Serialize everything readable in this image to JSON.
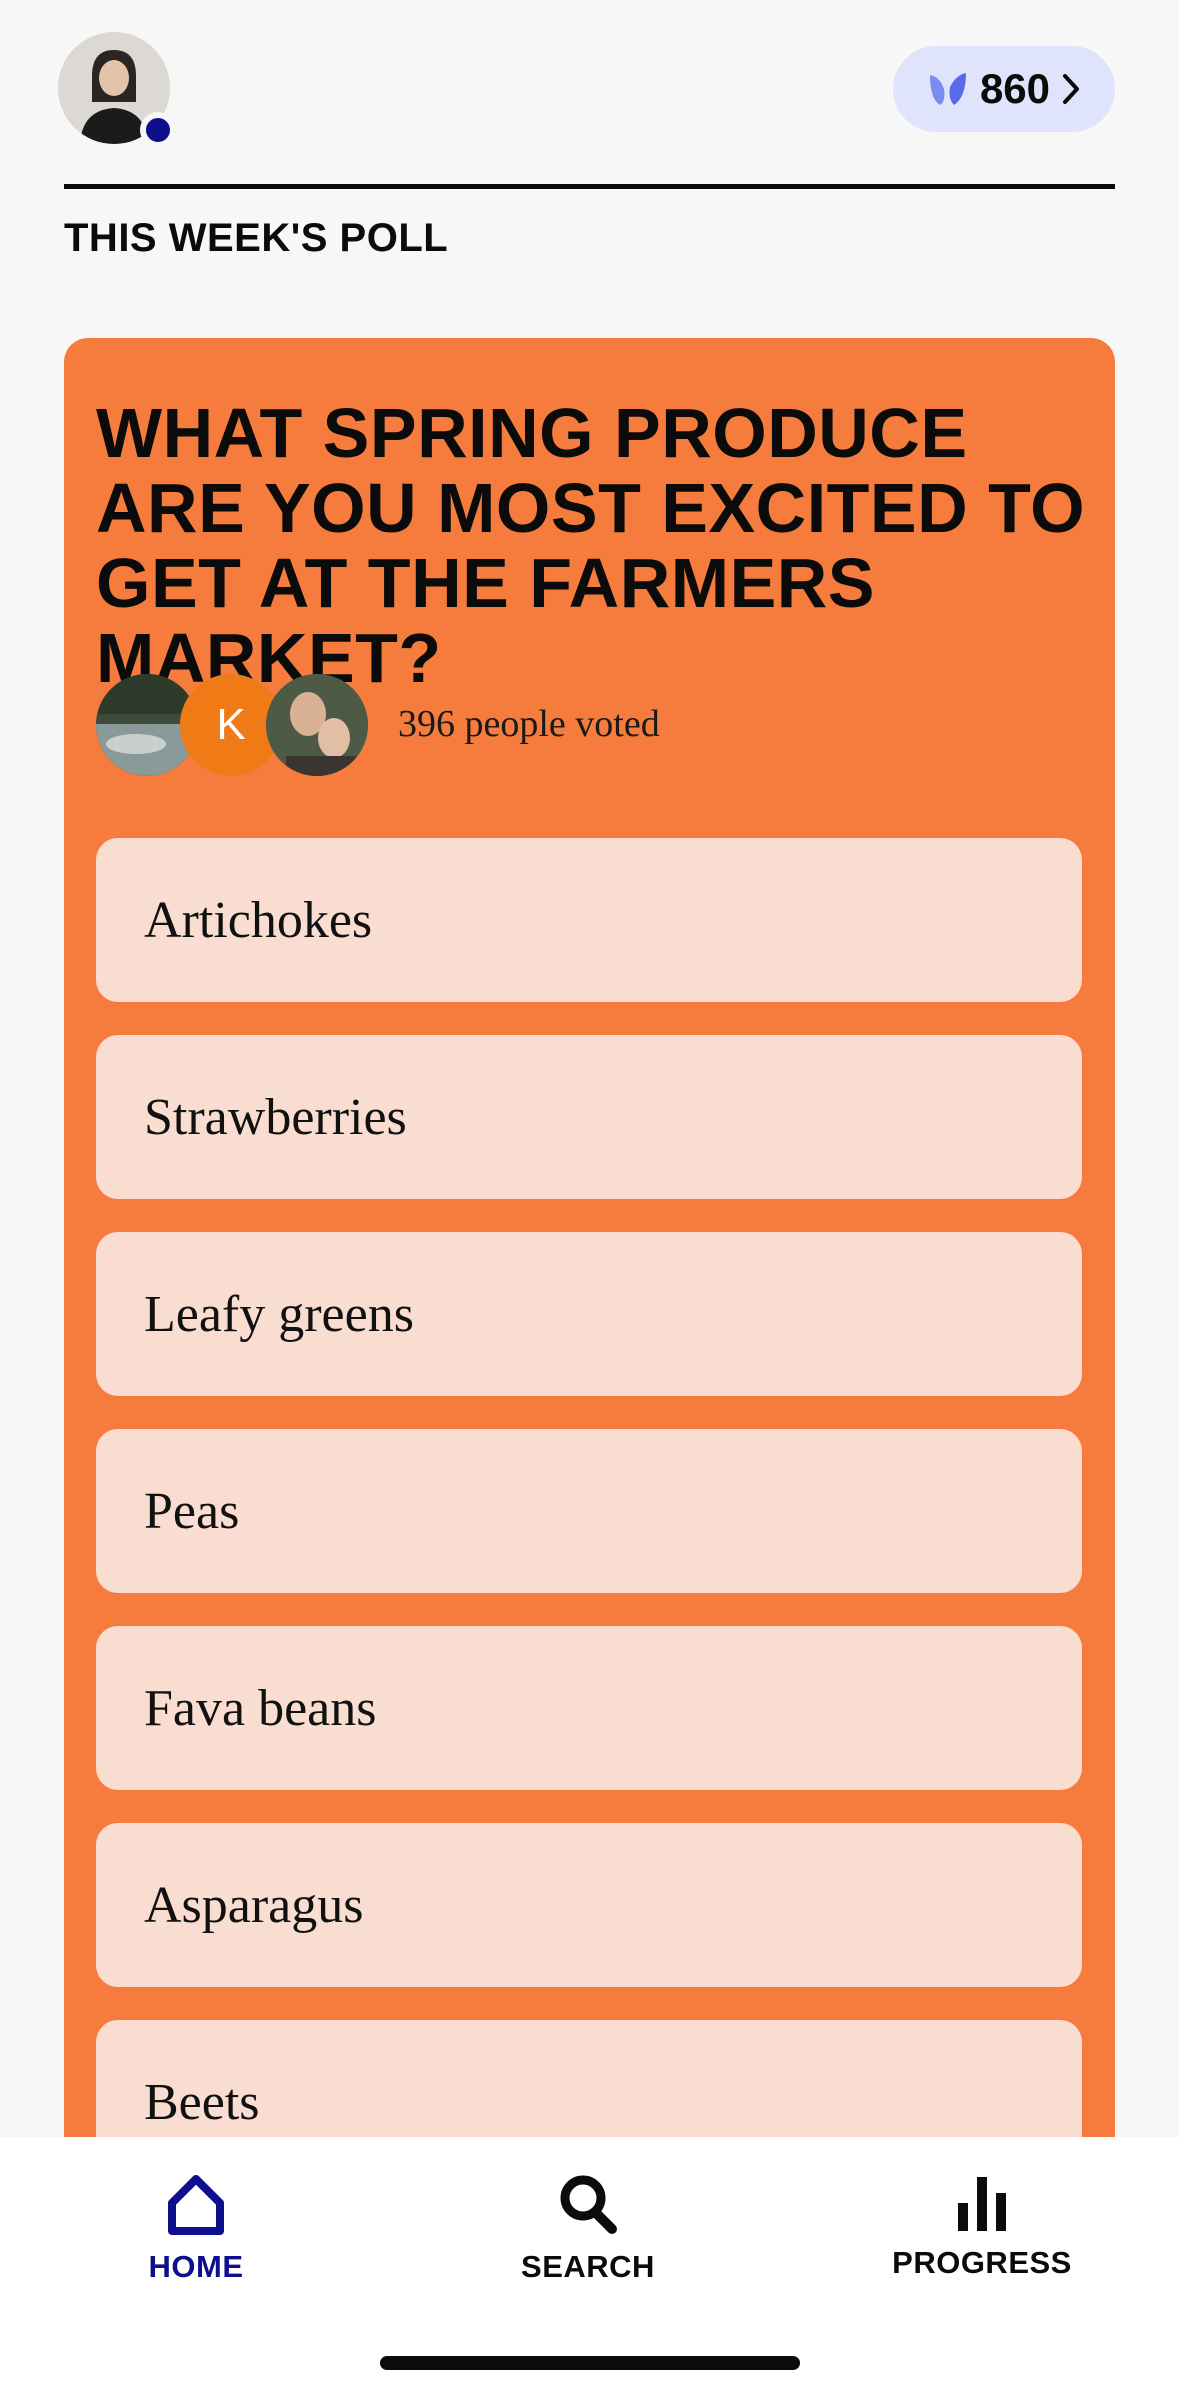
{
  "header": {
    "points": "860",
    "accent": "#0d0f8c"
  },
  "poll": {
    "section_title": "THIS WEEK'S POLL",
    "question": "WHAT SPRING PRODUCE ARE YOU MOST EXCITED TO GET AT THE FARMERS MARKET?",
    "voter_initial": "K",
    "votes_text": "396 people voted",
    "card_color": "#f57c3c",
    "options": [
      {
        "label": "Artichokes"
      },
      {
        "label": "Strawberries"
      },
      {
        "label": "Leafy greens"
      },
      {
        "label": "Peas"
      },
      {
        "label": "Fava beans"
      },
      {
        "label": "Asparagus"
      },
      {
        "label": "Beets"
      }
    ]
  },
  "nav": {
    "home": "HOME",
    "search": "SEARCH",
    "progress": "PROGRESS"
  }
}
